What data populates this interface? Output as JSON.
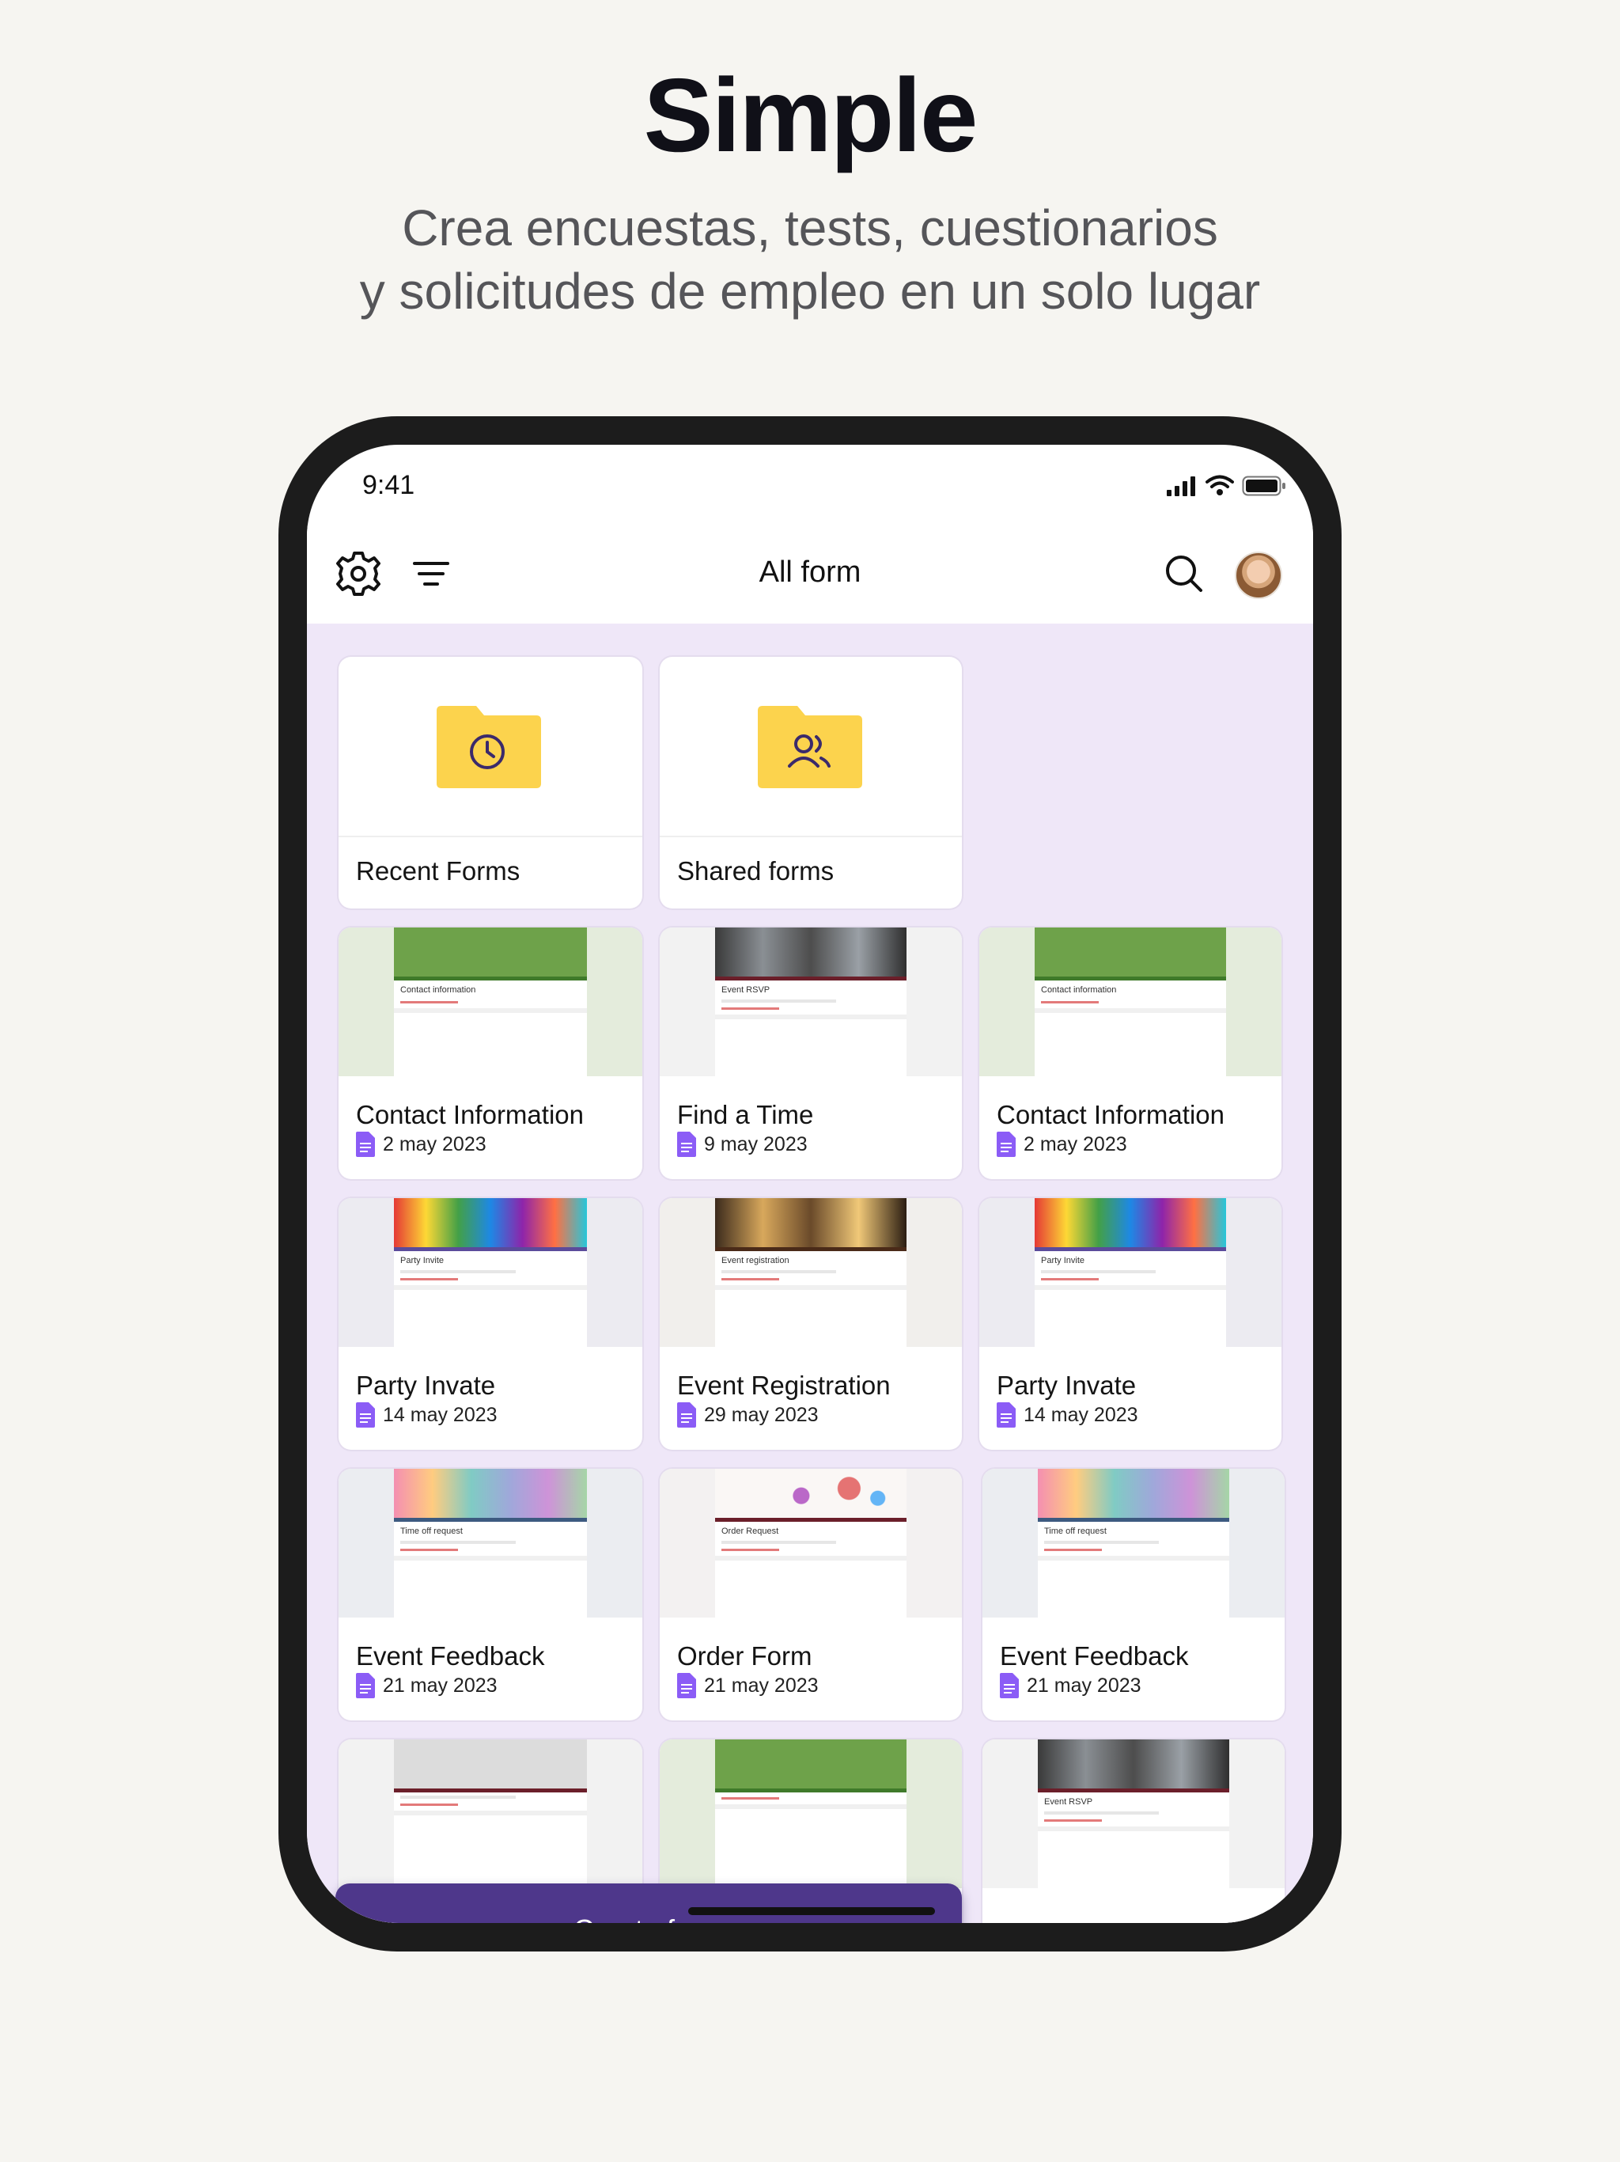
{
  "marketing": {
    "headline": "Simple",
    "subline_1": "Crea encuestas, tests, cuestionarios",
    "subline_2": "y solicitudes de empleo en un solo lugar"
  },
  "status_bar": {
    "time": "9:41"
  },
  "header": {
    "title": "All form",
    "left_icons": [
      "gear-icon",
      "filter-icon"
    ],
    "right_icons": [
      "search-icon",
      "avatar"
    ]
  },
  "folders": [
    {
      "label": "Recent Forms",
      "icon": "clock-icon"
    },
    {
      "label": "Shared forms",
      "icon": "users-icon"
    }
  ],
  "forms": [
    {
      "title": "Contact Information",
      "date": "2 may 2023",
      "thumb": "Contact information"
    },
    {
      "title": "Find a Time",
      "date": "9 may 2023",
      "thumb": "Event RSVP"
    },
    {
      "title": "Contact Information",
      "date": "2 may 2023",
      "thumb": "Contact information"
    },
    {
      "title": "Party Invate",
      "date": "14 may 2023",
      "thumb": "Party Invite"
    },
    {
      "title": "Event Registration",
      "date": "29 may 2023",
      "thumb": "Event registration"
    },
    {
      "title": "Party Invate",
      "date": "14 may 2023",
      "thumb": "Party Invite"
    },
    {
      "title": "Event Feedback",
      "date": "21 may 2023",
      "thumb": "Time off request"
    },
    {
      "title": "Order Form",
      "date": "21 may 2023",
      "thumb": "Order Request"
    },
    {
      "title": "Event Feedback",
      "date": "21 may 2023",
      "thumb": "Time off request"
    },
    {
      "title": "",
      "date": "",
      "thumb": "Event RSVP"
    }
  ],
  "create_button": {
    "label": "Create form"
  },
  "colors": {
    "accent": "#4e378b",
    "background": "#efe7f8",
    "folder": "#fcd34d",
    "doc_icon": "#8b5cf6"
  }
}
